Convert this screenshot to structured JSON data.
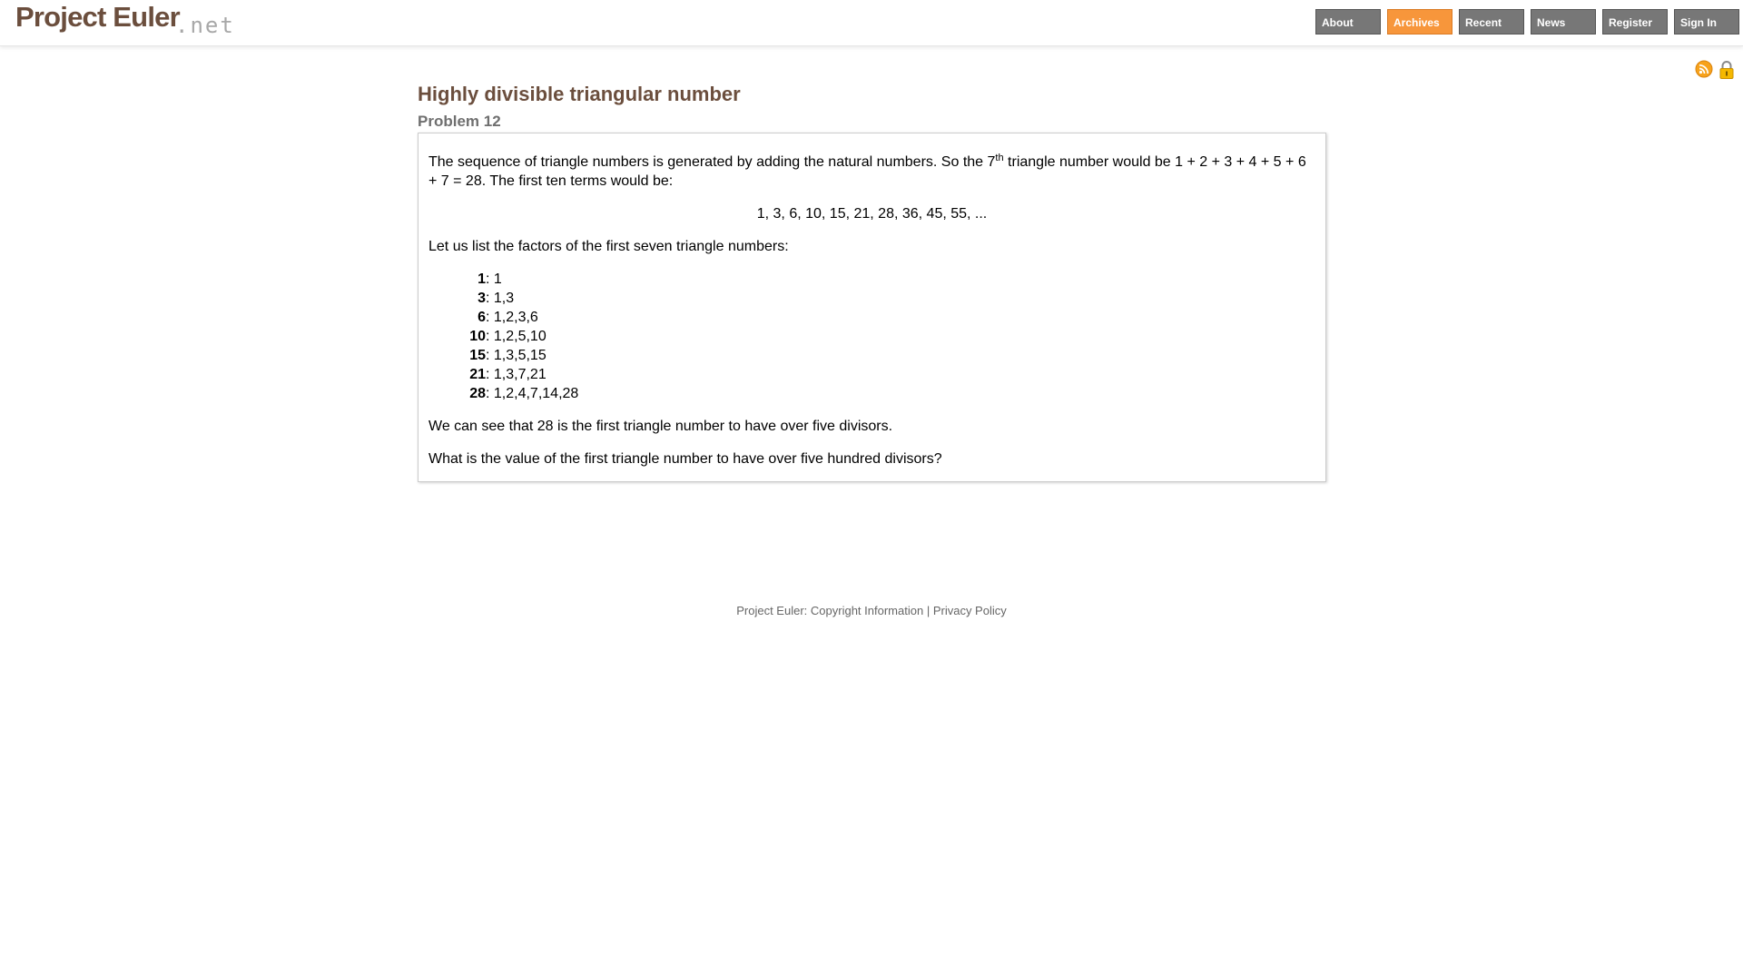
{
  "header": {
    "logo_text": "Project Euler",
    "logo_suffix": ".net",
    "nav": [
      {
        "label": "About",
        "active": false
      },
      {
        "label": "Archives",
        "active": true
      },
      {
        "label": "Recent",
        "active": false
      },
      {
        "label": "News",
        "active": false
      },
      {
        "label": "Register",
        "active": false
      },
      {
        "label": "Sign In",
        "active": false
      }
    ],
    "icons": [
      "rss-icon",
      "lock-icon"
    ],
    "accent_color": "#f7963b",
    "nav_color": "#777777",
    "title_color": "#6b4e3d"
  },
  "problem": {
    "title": "Highly divisible triangular number",
    "number_label": "Problem 12",
    "intro_before_sup": "The sequence of triangle numbers is generated by adding the natural numbers. So the 7",
    "intro_sup": "th",
    "intro_after_sup": " triangle number would be 1 + 2 + 3 + 4 + 5 + 6 + 7 = 28. The first ten terms would be:",
    "sequence": "1, 3, 6, 10, 15, 21, 28, 36, 45, 55, ...",
    "factors_intro": "Let us list the factors of the first seven triangle numbers:",
    "factors": [
      {
        "n": "1",
        "divisors": "1"
      },
      {
        "n": "3",
        "divisors": "1,3"
      },
      {
        "n": "6",
        "divisors": "1,2,3,6"
      },
      {
        "n": "10",
        "divisors": "1,2,5,10"
      },
      {
        "n": "15",
        "divisors": "1,3,5,15"
      },
      {
        "n": "21",
        "divisors": "1,3,7,21"
      },
      {
        "n": "28",
        "divisors": "1,2,4,7,14,28"
      }
    ],
    "observation": "We can see that 28 is the first triangle number to have over five divisors.",
    "question": "What is the value of the first triangle number to have over five hundred divisors?"
  },
  "footer": {
    "label": "Project Euler:",
    "copyright_link": "Copyright Information",
    "separator": "|",
    "privacy_link": "Privacy Policy"
  }
}
